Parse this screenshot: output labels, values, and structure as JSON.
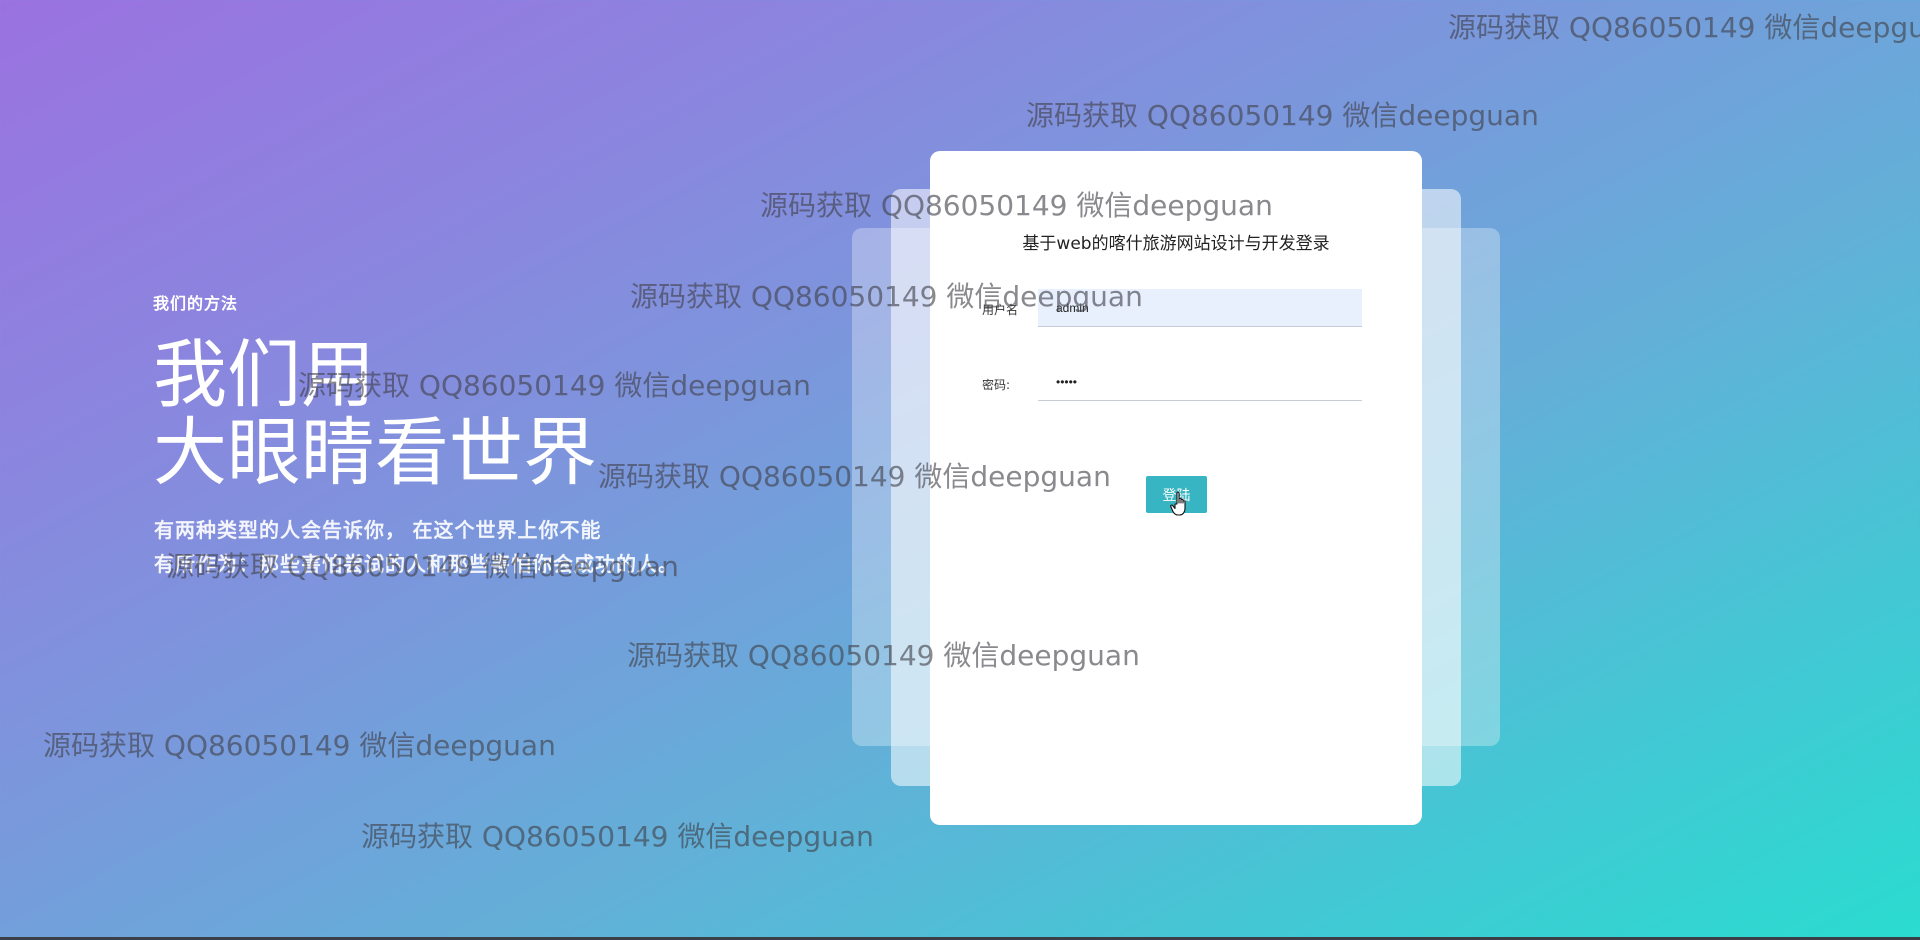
{
  "hero": {
    "eyebrow": "我们的方法",
    "headline_line1": "我们用",
    "headline_line2": "大眼睛看世界",
    "description_line1": "有两种类型的人会告诉你， 在这个世界上你不能",
    "description_line2": "有所作为：那些害怕尝试的人和那些害怕你会成功的人。"
  },
  "login": {
    "title": "基于web的喀什旅游网站设计与开发登录",
    "username_label": "用户名",
    "username_value": "admin",
    "password_label": "密码:",
    "password_value": "•••••",
    "login_button": "登陆"
  },
  "watermark": {
    "text": "源码获取 QQ86050149 微信deepguan"
  },
  "colors": {
    "gradient_start": "#9a72e0",
    "gradient_end": "#2adcd0",
    "button": "#38b5c2",
    "username_field_bg": "#e8f0fe"
  },
  "icons": {
    "cursor": "hand-pointer-icon"
  }
}
